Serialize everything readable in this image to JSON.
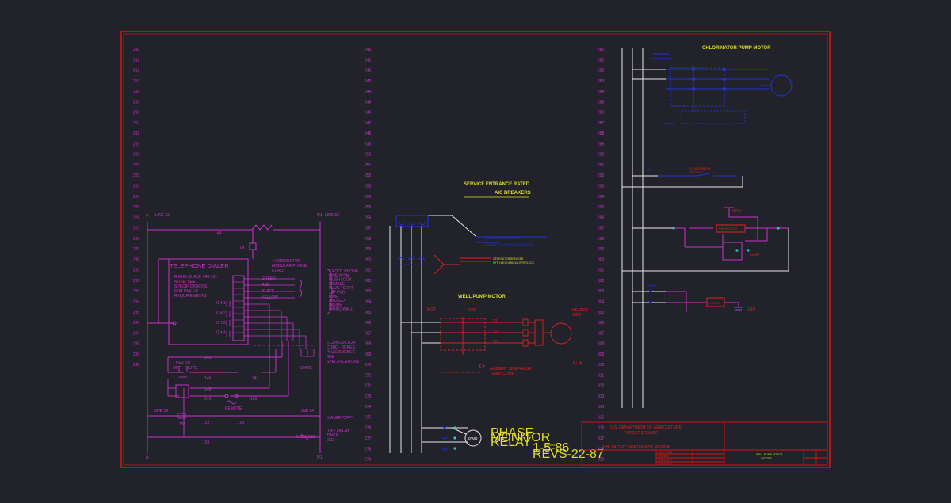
{
  "rungs": {
    "col1": [
      "210",
      "211",
      "212",
      "213",
      "214",
      "215",
      "216",
      "217",
      "218",
      "219",
      "220",
      "221",
      "222",
      "223",
      "224",
      "225",
      "226",
      "227",
      "228",
      "229",
      "230",
      "231",
      "232",
      "233",
      "234",
      "235",
      "236",
      "237",
      "238",
      "239",
      "240"
    ],
    "col2": [
      "240",
      "241",
      "242",
      "243",
      "244",
      "245",
      "246",
      "247",
      "248",
      "249",
      "250",
      "251",
      "252",
      "253",
      "254",
      "255",
      "256",
      "257",
      "258",
      "259",
      "260",
      "261",
      "262",
      "263",
      "264",
      "265",
      "266",
      "267",
      "268",
      "269",
      "270",
      "271",
      "272",
      "273",
      "274",
      "275",
      "276",
      "277",
      "278",
      "279"
    ],
    "col3": [
      "280",
      "281",
      "282",
      "283",
      "284",
      "285",
      "286",
      "287",
      "288",
      "289",
      "290",
      "291",
      "292",
      "293",
      "294",
      "295",
      "296",
      "297",
      "298",
      "299",
      "300",
      "301",
      "302",
      "303",
      "304",
      "305",
      "306",
      "307",
      "308",
      "309",
      "310",
      "311",
      "312",
      "313",
      "314",
      "315",
      "316",
      "317",
      "318",
      "319"
    ]
  },
  "dialer": {
    "line_label_left": "LINE 52",
    "line_label_right": "LINE 52",
    "n1_label": "N1",
    "a_label": "A",
    "bus_label": "144",
    "tb_label": "TB",
    "title": "TELEPHONE DIALER",
    "note_lines": [
      "RADIO SHACK #43-101",
      "NOTE: SEE",
      "SPECIFICATIONS",
      "FOR DIALER",
      "REQUIREMENTS"
    ],
    "phone_note": [
      "4 CONDUCTOR",
      "MODULAR PHONE",
      "CORD"
    ],
    "wire_colors": [
      "GREEN",
      "RED",
      "BLACK",
      "YELLOW"
    ],
    "right_note": [
      "6 FOOT PHONE",
      "LINE WITH",
      "PUSH LOCK",
      "FEMALE",
      "PLUG TO FIT",
      "1/2\" PVC",
      "PIPE",
      "AND GO",
      "INSIDE",
      "PANEL WALL"
    ],
    "channels": [
      "CH-1",
      "CH-2",
      "CH-3",
      "CH-4"
    ],
    "conductor_note": [
      "6 CONDUCTOR",
      "CORD - JONES",
      "PLUG/SOCKET,",
      "SEE",
      "SPECIFICATIONS"
    ],
    "spare_label": "SPARE",
    "switch_label": "DIALER",
    "off_label": "OFF",
    "auto_label": "AUTO",
    "remote_label": "REMOTE",
    "wire_labels": [
      "145",
      "146",
      "147",
      "148",
      "149",
      "150",
      "151",
      "152",
      "153",
      "154"
    ],
    "line54_left": "LINE 54",
    "line54_right": "LINE 54",
    "dialer_off": "DIALER \"OFF\"",
    "off_delay": [
      "\"OFF DELAY\"",
      "TIMER",
      "2XD"
    ],
    "sec_label": "0-180 SEC",
    "n1_bottom": "N1",
    "a_bottom": "A"
  },
  "well": {
    "service_title_1": "SERVICE ENTRANCE RATED",
    "service_title_2": "AIC BREAKERS",
    "breaker_label": "MAIN CIRCUIT BREAKER",
    "breaker_note": "CONNECT TO SERVICE ENTRANCE",
    "gen_label": "GENERATOR BREAKER",
    "gen_note": "WITH MECHANICAL INTERLOCK",
    "motor_title": "WELL PUMP MOTOR",
    "mcp_label": "MCP",
    "size_label": "SIZE",
    "heater_label": [
      "HEATER",
      "SIZE"
    ],
    "terminals": [
      "T1",
      "T2",
      "T3"
    ],
    "fla_label": "F.L.A.",
    "ambient_note": [
      "AMBIENT SINE VALUE",
      "TEMP. COMP."
    ],
    "pwr_label": "PWR",
    "phase_label": [
      "PHASE",
      "MONITOR",
      "RELAY"
    ],
    "note_numbers": [
      "1-5-86",
      "REVS-22-87"
    ],
    "drawing_ref": "0200000"
  },
  "chlor": {
    "title": "CHLORINATOR PUMP MOTOR",
    "cr_label": "CR",
    "float_label": [
      "FLOAT/SWITCH",
      "SETTING"
    ],
    "grd_label": "GRD",
    "thermostat_label": "THERMOSTAT",
    "heater_label": "HEATER",
    "spare_label": "SPARE"
  },
  "titleblock": {
    "dept": "U.S. DEPARTMENT OF AGRICULTURE",
    "service": "FOREST SERVICE",
    "region": "THE PACIFIC NORTHWEST REGION",
    "rows": [
      "DESIGNED",
      "DRAWN",
      "CHECKED",
      "APPROVED"
    ],
    "project": "WELL PUMP MOTOR",
    "sheet": "LADDER"
  }
}
